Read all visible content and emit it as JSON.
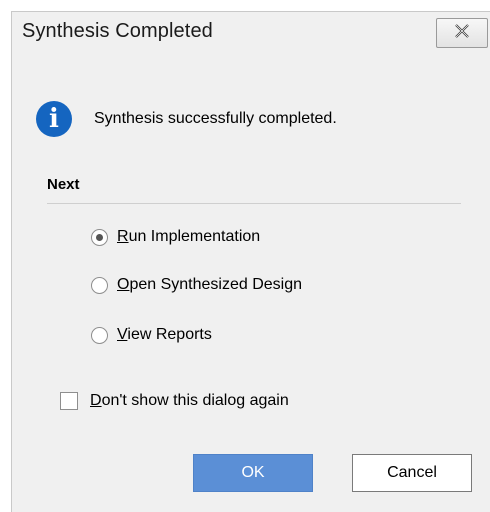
{
  "dialog": {
    "title": "Synthesis Completed",
    "message": "Synthesis successfully completed.",
    "section_label": "Next",
    "options": [
      {
        "mnemonic": "R",
        "rest": "un Implementation",
        "selected": true
      },
      {
        "mnemonic": "O",
        "rest": "pen Synthesized Design",
        "selected": false
      },
      {
        "mnemonic": "V",
        "rest": "iew Reports",
        "selected": false
      }
    ],
    "dont_show": {
      "mnemonic": "D",
      "rest": "on't show this dialog again",
      "checked": false
    },
    "ok_label": "OK",
    "cancel_label": "Cancel"
  },
  "colors": {
    "info_icon": "#1565c0",
    "ok_button": "#5b8fd6",
    "dialog_bg": "#f0f0f0"
  },
  "icons": {
    "info": "info-icon",
    "close": "close-icon"
  }
}
